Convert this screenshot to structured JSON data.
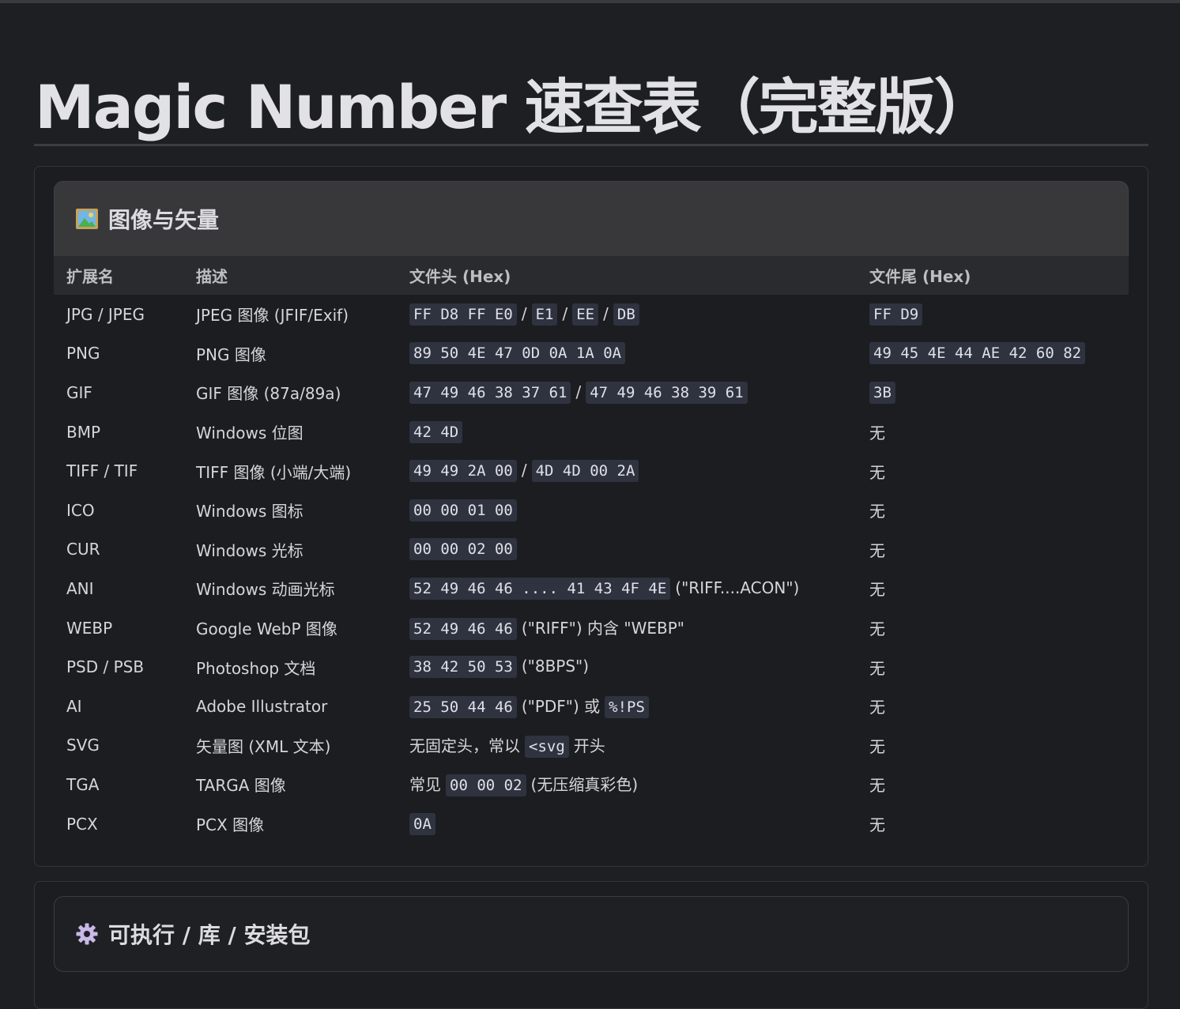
{
  "page": {
    "title": "Magic Number 速查表（完整版）"
  },
  "sections": [
    {
      "icon": "framed-picture-icon",
      "title": "图像与矢量",
      "headers": [
        "扩展名",
        "描述",
        "文件头 (Hex)",
        "文件尾 (Hex)"
      ],
      "rows": [
        {
          "ext": "JPG / JPEG",
          "desc": "JPEG 图像 (JFIF/Exif)",
          "head": [
            {
              "c": "FF D8 FF E0"
            },
            {
              "t": "/"
            },
            {
              "c": "E1"
            },
            {
              "t": "/"
            },
            {
              "c": "EE"
            },
            {
              "t": "/"
            },
            {
              "c": "DB"
            }
          ],
          "tail": [
            {
              "c": "FF D9"
            }
          ]
        },
        {
          "ext": "PNG",
          "desc": "PNG 图像",
          "head": [
            {
              "c": "89 50 4E 47 0D 0A 1A 0A"
            }
          ],
          "tail": [
            {
              "c": "49 45 4E 44 AE 42 60 82"
            }
          ]
        },
        {
          "ext": "GIF",
          "desc": "GIF 图像 (87a/89a)",
          "head": [
            {
              "c": "47 49 46 38 37 61"
            },
            {
              "t": "/"
            },
            {
              "c": "47 49 46 38 39 61"
            }
          ],
          "tail": [
            {
              "c": "3B"
            }
          ]
        },
        {
          "ext": "BMP",
          "desc": "Windows 位图",
          "head": [
            {
              "c": "42 4D"
            }
          ],
          "tail": [
            {
              "t": "无"
            }
          ]
        },
        {
          "ext": "TIFF / TIF",
          "desc": "TIFF 图像 (小端/大端)",
          "head": [
            {
              "c": "49 49 2A 00"
            },
            {
              "t": "/"
            },
            {
              "c": "4D 4D 00 2A"
            }
          ],
          "tail": [
            {
              "t": "无"
            }
          ]
        },
        {
          "ext": "ICO",
          "desc": "Windows 图标",
          "head": [
            {
              "c": "00 00 01 00"
            }
          ],
          "tail": [
            {
              "t": "无"
            }
          ]
        },
        {
          "ext": "CUR",
          "desc": "Windows 光标",
          "head": [
            {
              "c": "00 00 02 00"
            }
          ],
          "tail": [
            {
              "t": "无"
            }
          ]
        },
        {
          "ext": "ANI",
          "desc": "Windows 动画光标",
          "head": [
            {
              "c": "52 49 46 46 .... 41 43 4F 4E"
            },
            {
              "s": "(\"RIFF....ACON\")"
            }
          ],
          "tail": [
            {
              "t": "无"
            }
          ]
        },
        {
          "ext": "WEBP",
          "desc": "Google WebP 图像",
          "head": [
            {
              "c": "52 49 46 46"
            },
            {
              "s": "(\"RIFF\") 内含 \"WEBP\""
            }
          ],
          "tail": [
            {
              "t": "无"
            }
          ]
        },
        {
          "ext": "PSD / PSB",
          "desc": "Photoshop 文档",
          "head": [
            {
              "c": "38 42 50 53"
            },
            {
              "s": "(\"8BPS\")"
            }
          ],
          "tail": [
            {
              "t": "无"
            }
          ]
        },
        {
          "ext": "AI",
          "desc": "Adobe Illustrator",
          "head": [
            {
              "c": "25 50 44 46"
            },
            {
              "s": "(\"PDF\") 或"
            },
            {
              "c": "%!PS",
              "sp": true
            }
          ],
          "tail": [
            {
              "t": "无"
            }
          ]
        },
        {
          "ext": "SVG",
          "desc": "矢量图 (XML 文本)",
          "head": [
            {
              "t": "无固定头，常以"
            },
            {
              "c": "<svg",
              "sp": true
            },
            {
              "s": "开头"
            }
          ],
          "tail": [
            {
              "t": "无"
            }
          ]
        },
        {
          "ext": "TGA",
          "desc": "TARGA 图像",
          "head": [
            {
              "t": "常见"
            },
            {
              "c": "00 00 02",
              "sp": true
            },
            {
              "s": "(无压缩真彩色)"
            }
          ],
          "tail": [
            {
              "t": "无"
            }
          ]
        },
        {
          "ext": "PCX",
          "desc": "PCX 图像",
          "head": [
            {
              "c": "0A"
            }
          ],
          "tail": [
            {
              "t": "无"
            }
          ]
        }
      ]
    },
    {
      "icon": "gear-icon",
      "title": "可执行 / 库 / 安装包"
    }
  ],
  "colors": {
    "background": "#1e1f22",
    "code_bg": "#2f3340",
    "header_bg": "#38383b"
  }
}
